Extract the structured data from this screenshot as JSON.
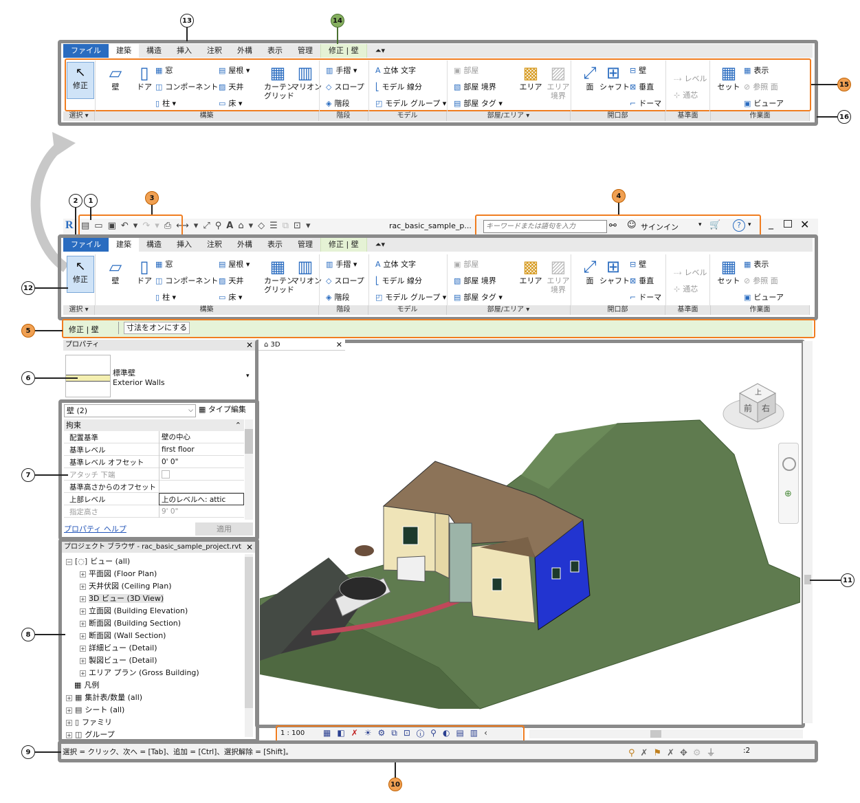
{
  "callouts": {
    "c1": "1",
    "c2": "2",
    "c3": "3",
    "c4": "4",
    "c5": "5",
    "c6": "6",
    "c7": "7",
    "c8": "8",
    "c9": "9",
    "c10": "10",
    "c11": "11",
    "c12": "12",
    "c13": "13",
    "c14": "14",
    "c15": "15",
    "c16": "16"
  },
  "tabs": [
    "ファイル",
    "建築",
    "構造",
    "挿入",
    "注釈",
    "外構",
    "表示",
    "管理",
    "修正 | 壁"
  ],
  "ribbon": {
    "modify": "修正",
    "select": "選択 ▾",
    "wall": "壁",
    "door": "ドア",
    "window": "窓",
    "component": "コンポーネント",
    "column": "柱 ▾",
    "roof": "屋根 ▾",
    "ceiling": "天井",
    "floor": "床 ▾",
    "curtain_grid": "カーテン\nグリッド",
    "mullion": "マリオン",
    "railing": "手摺 ▾",
    "ramp": "スロープ",
    "stair": "階段",
    "model_text": "立体 文字",
    "model_line": "モデル 線分",
    "model_group": "モデル グループ ▾",
    "room": "部屋",
    "room_sep": "部屋 境界",
    "room_tag": "部屋 タグ ▾",
    "area": "エリア",
    "area_boundary": "エリア\n境界",
    "by_face": "面",
    "shaft": "シャフト",
    "wall_opening": "壁",
    "vertical": "垂直",
    "dormer": "ドーマ",
    "level": "レベル",
    "grid": "通芯",
    "set": "セット",
    "show": "表示",
    "ref_plane": "参照 面",
    "viewer": "ビューア",
    "panels": [
      "選択 ▾",
      "構築",
      "階段",
      "モデル",
      "部屋/エリア ▾",
      "開口部",
      "基準面",
      "作業面"
    ]
  },
  "qat": {
    "project_name": "rac_basic_sample_p...",
    "search_placeholder": "キーワードまたは語句を入力",
    "signin": "サインイン"
  },
  "options_bar": {
    "context": "修正 | 壁",
    "dimension": "寸法をオンにする"
  },
  "properties": {
    "title": "プロパティ",
    "type_name": "標準壁",
    "type_sub": "Exterior Walls",
    "selector": "壁 (2)",
    "type_edit": "タイプ編集",
    "category": "拘束",
    "rows": [
      {
        "k": "配置基準",
        "v": "壁の中心"
      },
      {
        "k": "基準レベル",
        "v": "first floor"
      },
      {
        "k": "基準レベル オフセット",
        "v": "0'  0\""
      },
      {
        "k": "アタッチ 下端",
        "v": ""
      },
      {
        "k": "基準高さからのオフセット",
        "v": ""
      },
      {
        "k": "上部レベル",
        "v": "上のレベルへ: attic"
      },
      {
        "k": "指定高さ",
        "v": "9'  0\""
      }
    ],
    "help": "プロパティ ヘルプ",
    "apply": "適用"
  },
  "browser": {
    "title": "プロジェクト ブラウザ - rac_basic_sample_project.rvt",
    "items": [
      "ビュー (all)",
      "平面図 (Floor Plan)",
      "天井伏図 (Ceiling Plan)",
      "3D ビュー (3D View)",
      "立面図 (Building Elevation)",
      "断面図 (Building Section)",
      "断面図 (Wall Section)",
      "詳細ビュー (Detail)",
      "製図ビュー (Detail)",
      "エリア プラン (Gross Building)",
      "凡例",
      "集計表/数量 (all)",
      "シート (all)",
      "ファミリ",
      "グループ"
    ]
  },
  "view": {
    "tab": "3D",
    "scale": "1 : 100",
    "cube_top": "上",
    "cube_front": "前",
    "cube_right": "右"
  },
  "status": {
    "text": "選択 = クリック、次へ = [Tab]、追加 = [Ctrl]、選択解除 = [Shift]。",
    "filter": ":2"
  },
  "colors": {
    "orange": "#f07d20",
    "frame": "#8a8a8a",
    "file_tab": "#2a6cc0",
    "context_tab": "#e5f2d5",
    "ground": "#5e7a4e",
    "roof": "#8c7358",
    "wall_blue": "#2234d0"
  }
}
